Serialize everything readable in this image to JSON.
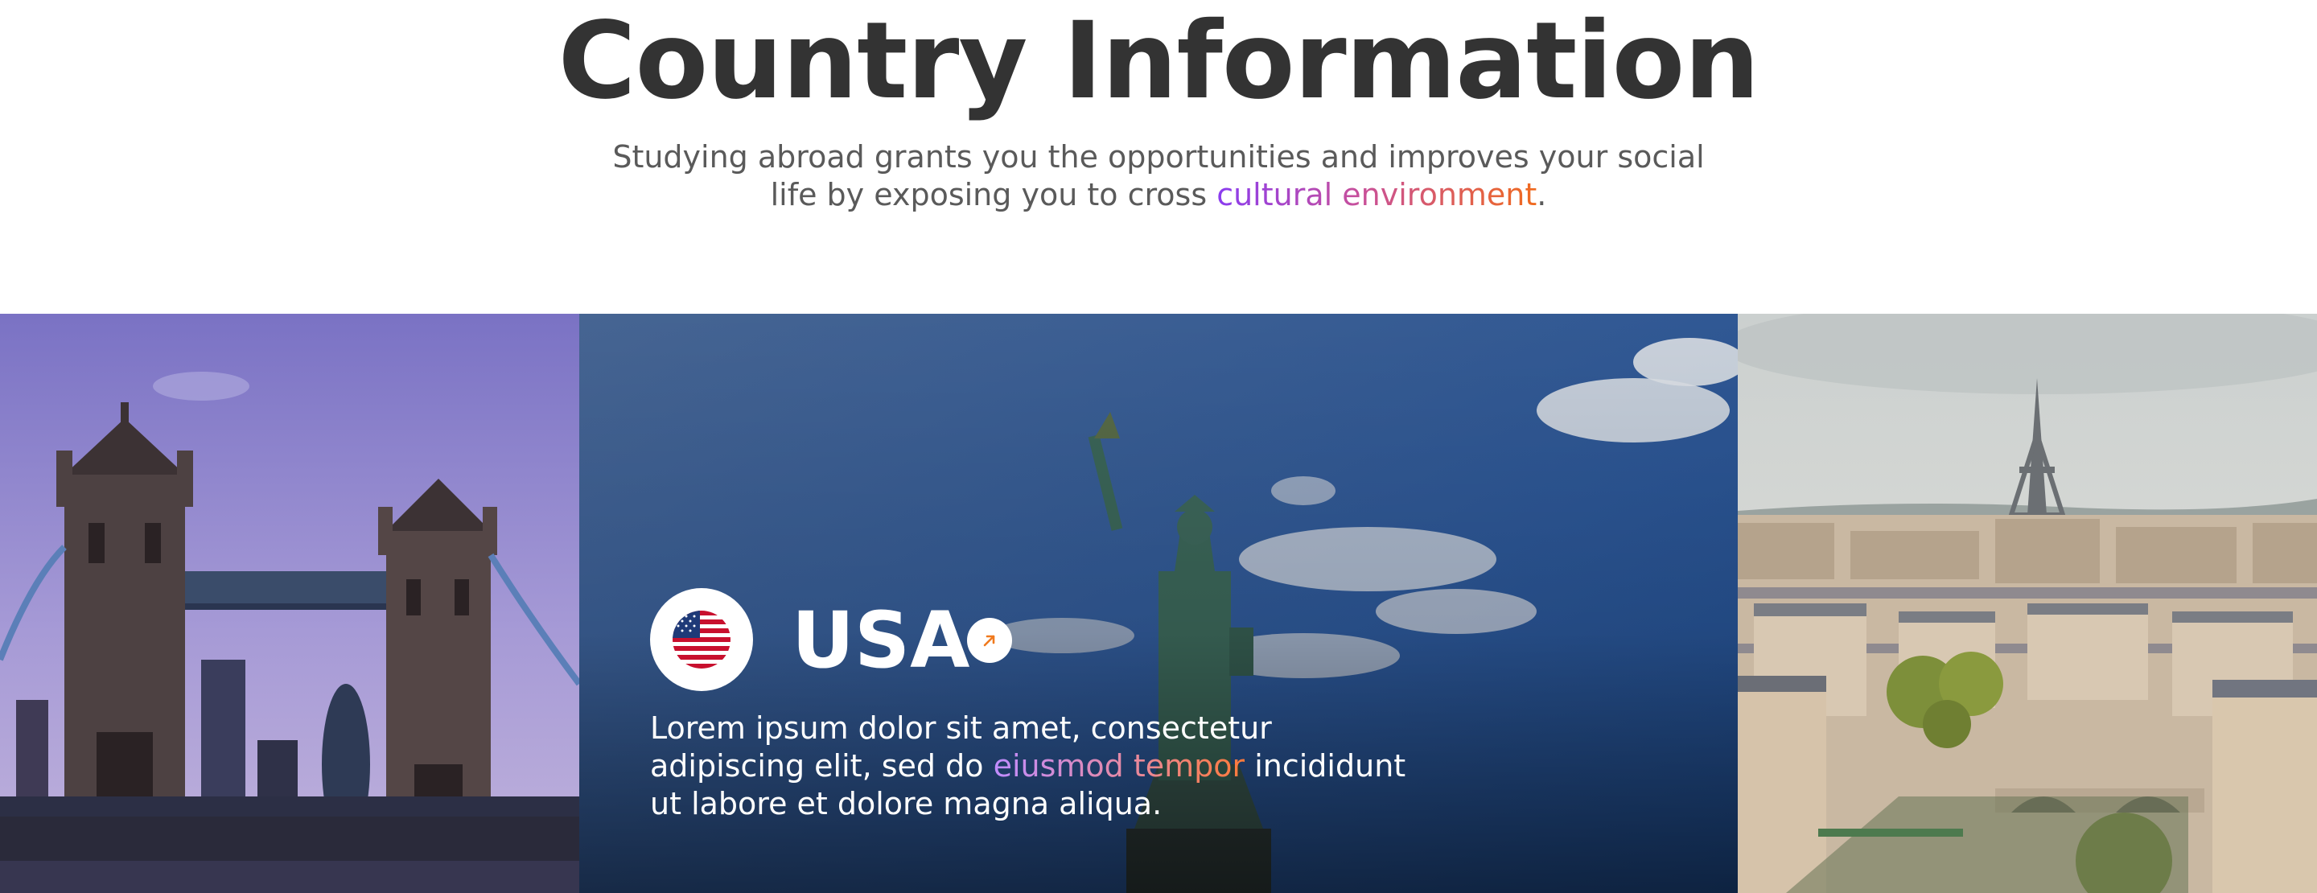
{
  "header": {
    "title": "Country Information",
    "subtitle_before": "Studying abroad grants you the opportunities and improves your social life by exposing you to cross ",
    "subtitle_highlight": "cultural environment",
    "subtitle_after": "."
  },
  "featured": {
    "country": "USA",
    "desc_before": "Lorem ipsum dolor sit amet, consectetur adipiscing elit, sed do ",
    "desc_highlight": "eiusmod tempor",
    "desc_after": " incididunt ut labore et dolore magna aliqua."
  },
  "icons": {
    "flag": "usa-flag-icon",
    "arrow": "arrow-up-right-icon"
  },
  "colors": {
    "gradient_start": "#8a3cf0",
    "gradient_end": "#f06a1e",
    "title": "#333333"
  }
}
